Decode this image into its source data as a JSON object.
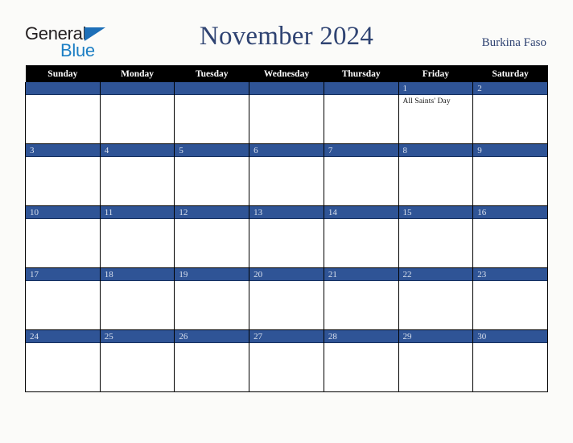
{
  "brand": {
    "name_part1": "General",
    "name_part2": "Blue",
    "triangle_icon": "triangle-icon",
    "color_dark": "#231f20",
    "color_blue": "#1d7fc4"
  },
  "header": {
    "title": "November 2024",
    "country": "Burkina Faso",
    "title_color": "#2f4372"
  },
  "calendar": {
    "weekdays": [
      "Sunday",
      "Monday",
      "Tuesday",
      "Wednesday",
      "Thursday",
      "Friday",
      "Saturday"
    ],
    "header_bg": "#000000",
    "daybar_bg": "#2f5496",
    "daybar_text_color": "#dbe2ef",
    "weeks": [
      [
        {
          "day": "",
          "events": []
        },
        {
          "day": "",
          "events": []
        },
        {
          "day": "",
          "events": []
        },
        {
          "day": "",
          "events": []
        },
        {
          "day": "",
          "events": []
        },
        {
          "day": "1",
          "events": [
            "All Saints' Day"
          ]
        },
        {
          "day": "2",
          "events": []
        }
      ],
      [
        {
          "day": "3",
          "events": []
        },
        {
          "day": "4",
          "events": []
        },
        {
          "day": "5",
          "events": []
        },
        {
          "day": "6",
          "events": []
        },
        {
          "day": "7",
          "events": []
        },
        {
          "day": "8",
          "events": []
        },
        {
          "day": "9",
          "events": []
        }
      ],
      [
        {
          "day": "10",
          "events": []
        },
        {
          "day": "11",
          "events": []
        },
        {
          "day": "12",
          "events": []
        },
        {
          "day": "13",
          "events": []
        },
        {
          "day": "14",
          "events": []
        },
        {
          "day": "15",
          "events": []
        },
        {
          "day": "16",
          "events": []
        }
      ],
      [
        {
          "day": "17",
          "events": []
        },
        {
          "day": "18",
          "events": []
        },
        {
          "day": "19",
          "events": []
        },
        {
          "day": "20",
          "events": []
        },
        {
          "day": "21",
          "events": []
        },
        {
          "day": "22",
          "events": []
        },
        {
          "day": "23",
          "events": []
        }
      ],
      [
        {
          "day": "24",
          "events": []
        },
        {
          "day": "25",
          "events": []
        },
        {
          "day": "26",
          "events": []
        },
        {
          "day": "27",
          "events": []
        },
        {
          "day": "28",
          "events": []
        },
        {
          "day": "29",
          "events": []
        },
        {
          "day": "30",
          "events": []
        }
      ]
    ]
  }
}
